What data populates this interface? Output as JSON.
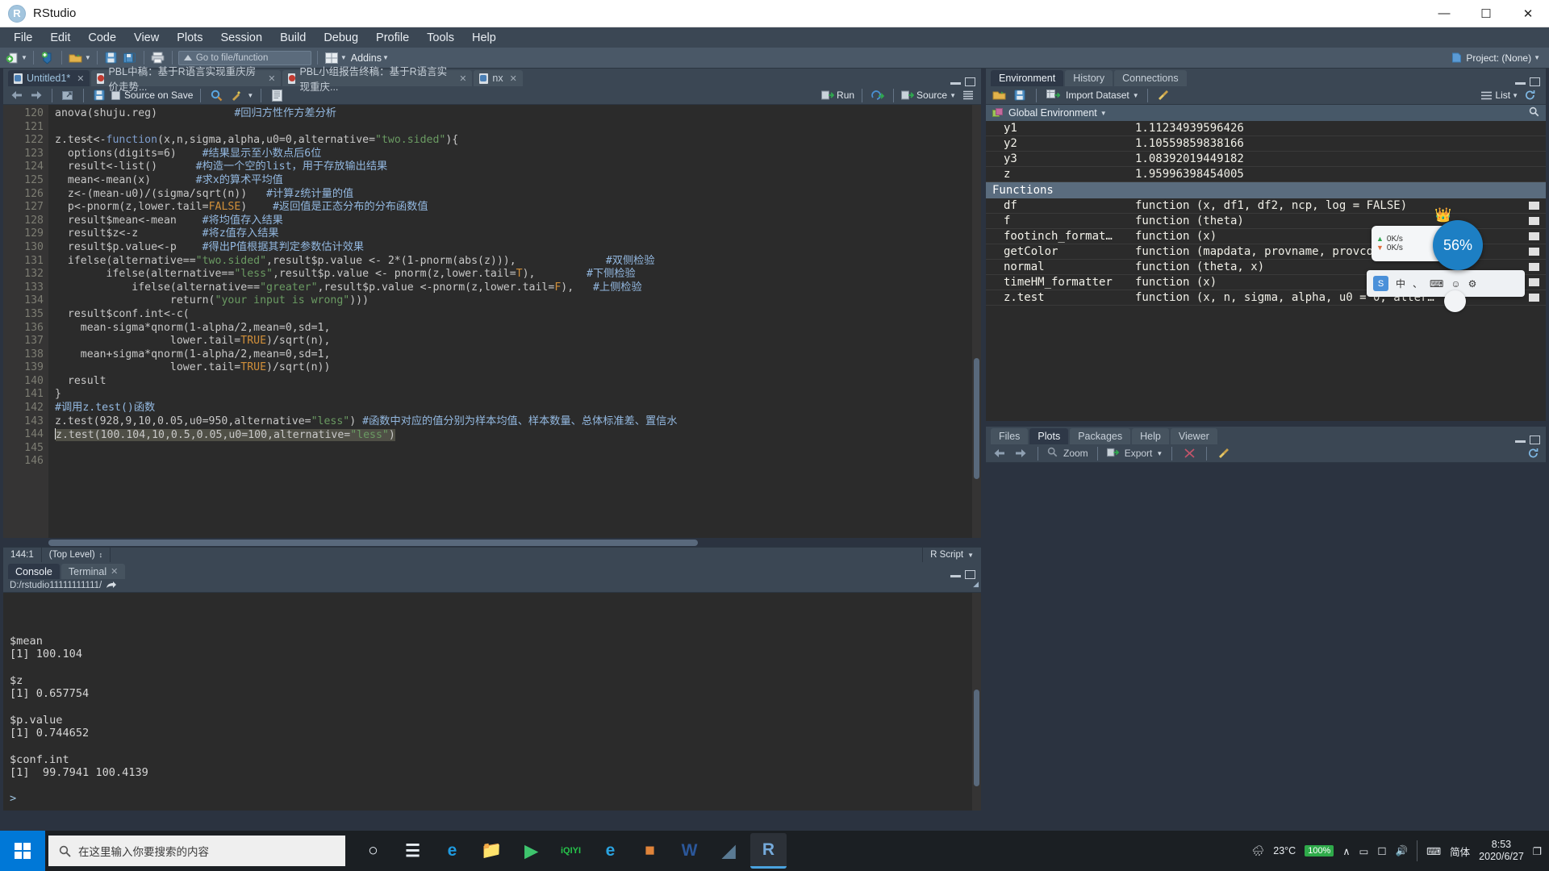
{
  "window": {
    "app_title": "RStudio",
    "logo_letter": "R",
    "minimize": "—",
    "maximize": "☐",
    "close": "✕"
  },
  "menubar": {
    "items": [
      "File",
      "Edit",
      "Code",
      "View",
      "Plots",
      "Session",
      "Build",
      "Debug",
      "Profile",
      "Tools",
      "Help"
    ]
  },
  "toolbar": {
    "goto_placeholder": "Go to file/function",
    "addins_label": "Addins",
    "project_label": "Project: (None)"
  },
  "source": {
    "tabs": [
      {
        "label": "Untitled1*",
        "icon": "r-file-icon",
        "active": true
      },
      {
        "label": "PBL中稿：基于R语言实现重庆房价走势...",
        "icon": "rmd-file-icon",
        "active": false
      },
      {
        "label": "PBL小组报告终稿：基于R语言实现重庆...",
        "icon": "rmd-file-icon",
        "active": false
      },
      {
        "label": "nx",
        "icon": "r-file-icon",
        "active": false
      }
    ],
    "toolbar": {
      "source_on_save": "Source on Save",
      "run_label": "Run",
      "source_label": "Source"
    },
    "status": {
      "position": "144:1",
      "scope": "(Top Level)",
      "filetype": "R Script"
    },
    "first_line_number": 120,
    "lines": [
      {
        "n": 120,
        "clipped": true,
        "tokens": [
          {
            "t": "anova(shuju.reg)",
            "c": "k-op"
          },
          {
            "t": "            #回归方性作方差分析",
            "c": "k-cmt"
          }
        ]
      },
      {
        "n": 121,
        "tokens": []
      },
      {
        "n": 122,
        "fold": true,
        "tokens": [
          {
            "t": "z.test<-",
            "c": "k-op"
          },
          {
            "t": "function",
            "c": "k-fn"
          },
          {
            "t": "(x,n,sigma,alpha,u0=0,alternative=",
            "c": "k-op"
          },
          {
            "t": "\"two.sided\"",
            "c": "k-str"
          },
          {
            "t": "){",
            "c": "k-op"
          }
        ]
      },
      {
        "n": 123,
        "tokens": [
          {
            "t": "  options(digits=6)",
            "c": "k-op"
          },
          {
            "t": "    #结果显示至小数点后6位",
            "c": "k-cmt"
          }
        ]
      },
      {
        "n": 124,
        "tokens": [
          {
            "t": "  result<-list()",
            "c": "k-op"
          },
          {
            "t": "      #构造一个空的list，用于存放输出结果",
            "c": "k-cmt"
          }
        ]
      },
      {
        "n": 125,
        "tokens": [
          {
            "t": "  mean<-mean(x)",
            "c": "k-op"
          },
          {
            "t": "       #求x的算术平均值",
            "c": "k-cmt"
          }
        ]
      },
      {
        "n": 126,
        "tokens": [
          {
            "t": "  z<-(mean-u0)/(sigma/sqrt(n))",
            "c": "k-op"
          },
          {
            "t": "   #计算z统计量的值",
            "c": "k-cmt"
          }
        ]
      },
      {
        "n": 127,
        "tokens": [
          {
            "t": "  p<-pnorm(z,lower.tail=",
            "c": "k-op"
          },
          {
            "t": "FALSE",
            "c": "k-const"
          },
          {
            "t": ")",
            "c": "k-op"
          },
          {
            "t": "    #返回值是正态分布的分布函数值",
            "c": "k-cmt"
          }
        ]
      },
      {
        "n": 128,
        "tokens": [
          {
            "t": "  result$mean<-mean",
            "c": "k-op"
          },
          {
            "t": "    #将均值存入结果",
            "c": "k-cmt"
          }
        ]
      },
      {
        "n": 129,
        "tokens": [
          {
            "t": "  result$z<-z",
            "c": "k-op"
          },
          {
            "t": "          #将z值存入结果",
            "c": "k-cmt"
          }
        ]
      },
      {
        "n": 130,
        "tokens": [
          {
            "t": "  result$p.value<-p",
            "c": "k-op"
          },
          {
            "t": "    #得出P值根据其判定参数估计效果",
            "c": "k-cmt"
          }
        ]
      },
      {
        "n": 131,
        "tokens": [
          {
            "t": "  ifelse(alternative==",
            "c": "k-op"
          },
          {
            "t": "\"two.sided\"",
            "c": "k-str"
          },
          {
            "t": ",result$p.value <- 2*(1-pnorm(abs(z))),",
            "c": "k-op"
          },
          {
            "t": "              #双侧检验",
            "c": "k-cmt"
          }
        ]
      },
      {
        "n": 132,
        "tokens": [
          {
            "t": "        ifelse(alternative==",
            "c": "k-op"
          },
          {
            "t": "\"less\"",
            "c": "k-str"
          },
          {
            "t": ",result$p.value <- pnorm(z,lower.tail=",
            "c": "k-op"
          },
          {
            "t": "T",
            "c": "k-const"
          },
          {
            "t": "),",
            "c": "k-op"
          },
          {
            "t": "        #下侧检验",
            "c": "k-cmt"
          }
        ]
      },
      {
        "n": 133,
        "tokens": [
          {
            "t": "            ifelse(alternative==",
            "c": "k-op"
          },
          {
            "t": "\"greater\"",
            "c": "k-str"
          },
          {
            "t": ",result$p.value <-pnorm(z,lower.tail=",
            "c": "k-op"
          },
          {
            "t": "F",
            "c": "k-const"
          },
          {
            "t": "),",
            "c": "k-op"
          },
          {
            "t": "   #上侧检验",
            "c": "k-cmt"
          }
        ]
      },
      {
        "n": 134,
        "tokens": [
          {
            "t": "                  return(",
            "c": "k-op"
          },
          {
            "t": "\"your input is wrong\"",
            "c": "k-str"
          },
          {
            "t": ")))",
            "c": "k-op"
          }
        ]
      },
      {
        "n": 135,
        "tokens": [
          {
            "t": "  result$conf.int<-c(",
            "c": "k-op"
          }
        ]
      },
      {
        "n": 136,
        "tokens": [
          {
            "t": "    mean-sigma*qnorm(1-alpha/2,mean=0,sd=1,",
            "c": "k-op"
          }
        ]
      },
      {
        "n": 137,
        "tokens": [
          {
            "t": "                  lower.tail=",
            "c": "k-op"
          },
          {
            "t": "TRUE",
            "c": "k-const"
          },
          {
            "t": ")/sqrt(n),",
            "c": "k-op"
          }
        ]
      },
      {
        "n": 138,
        "tokens": [
          {
            "t": "    mean+sigma*qnorm(1-alpha/2,mean=0,sd=1,",
            "c": "k-op"
          }
        ]
      },
      {
        "n": 139,
        "tokens": [
          {
            "t": "                  lower.tail=",
            "c": "k-op"
          },
          {
            "t": "TRUE",
            "c": "k-const"
          },
          {
            "t": ")/sqrt(n))",
            "c": "k-op"
          }
        ]
      },
      {
        "n": 140,
        "tokens": [
          {
            "t": "  result",
            "c": "k-op"
          }
        ]
      },
      {
        "n": 141,
        "tokens": [
          {
            "t": "}",
            "c": "k-op"
          }
        ]
      },
      {
        "n": 142,
        "tokens": [
          {
            "t": "#调用z.test()函数",
            "c": "k-cmt"
          }
        ]
      },
      {
        "n": 143,
        "tokens": [
          {
            "t": "z.test(928,9,10,0.05,u0=950,alternative=",
            "c": "k-op"
          },
          {
            "t": "\"less\"",
            "c": "k-str"
          },
          {
            "t": ")",
            "c": "k-op"
          },
          {
            "t": " #函数中对应的值分别为样本均值、样本数量、总体标准差、置信水",
            "c": "k-cmt"
          }
        ]
      },
      {
        "n": 144,
        "selected": true,
        "tokens": [
          {
            "t": "z.test(100.104,10,0.5,0.05,u0=100,alternative=",
            "c": "k-op"
          },
          {
            "t": "\"less\"",
            "c": "k-str"
          },
          {
            "t": ")",
            "c": "k-op"
          }
        ]
      },
      {
        "n": 145,
        "tokens": []
      },
      {
        "n": 146,
        "tokens": []
      }
    ]
  },
  "console": {
    "tabs": [
      {
        "label": "Console",
        "active": true,
        "closable": false
      },
      {
        "label": "Terminal",
        "active": false,
        "closable": true
      }
    ],
    "path": "D:/rstudio11111111111/",
    "output": [
      {
        "t": "$mean"
      },
      {
        "t": "[1] 100.104"
      },
      {
        "t": ""
      },
      {
        "t": "$z"
      },
      {
        "t": "[1] 0.657754"
      },
      {
        "t": ""
      },
      {
        "t": "$p.value"
      },
      {
        "t": "[1] 0.744652"
      },
      {
        "t": ""
      },
      {
        "t": "$conf.int"
      },
      {
        "t": "[1]  99.7941 100.4139"
      },
      {
        "t": ""
      },
      {
        "t": "> ",
        "prompt": true
      }
    ]
  },
  "environment": {
    "tabs": [
      {
        "label": "Environment",
        "active": true
      },
      {
        "label": "History",
        "active": false
      },
      {
        "label": "Connections",
        "active": false
      }
    ],
    "toolbar": {
      "import_dataset": "Import Dataset",
      "list_label": "List"
    },
    "scope": "Global Environment",
    "rows": [
      {
        "name": "y1",
        "value": "1.11234939596426",
        "type": "value"
      },
      {
        "name": "y2",
        "value": "1.10559859838166",
        "type": "value"
      },
      {
        "name": "y3",
        "value": "1.08392019449182",
        "type": "value"
      },
      {
        "name": "z",
        "value": "1.95996398454005",
        "type": "value"
      },
      {
        "name": "Functions",
        "section": true
      },
      {
        "name": "df",
        "value": "function (x, df1, df2, ncp, log = FALSE)",
        "type": "function"
      },
      {
        "name": "f",
        "value": "function (theta)",
        "type": "function"
      },
      {
        "name": "footinch_format…",
        "value": "function (x)",
        "type": "function"
      },
      {
        "name": "getColor",
        "value": "function (mapdata, provname, provcol, other…",
        "type": "function"
      },
      {
        "name": "normal",
        "value": "function (theta, x)",
        "type": "function"
      },
      {
        "name": "timeHM_formatter",
        "value": "function (x)",
        "type": "function"
      },
      {
        "name": "z.test",
        "value": "function (x, n, sigma, alpha, u0 = 0, alter…",
        "type": "function"
      }
    ]
  },
  "files_pane": {
    "tabs": [
      {
        "label": "Files",
        "active": false
      },
      {
        "label": "Plots",
        "active": true
      },
      {
        "label": "Packages",
        "active": false
      },
      {
        "label": "Help",
        "active": false
      },
      {
        "label": "Viewer",
        "active": false
      }
    ],
    "toolbar": {
      "zoom_label": "Zoom",
      "export_label": "Export"
    }
  },
  "floating": {
    "upload_rate": "0K/s",
    "download_rate": "0K/s",
    "percent": "56%",
    "ime_lang": "中",
    "ime_logo": "S"
  },
  "taskbar": {
    "search_placeholder": "在这里输入你要搜索的内容",
    "icons": [
      {
        "name": "cortana-icon",
        "glyph": "○",
        "color": "#e8eef4",
        "active": false
      },
      {
        "name": "task-view-icon",
        "glyph": "☰",
        "color": "#e8eef4",
        "active": false
      },
      {
        "name": "edge-icon",
        "glyph": "e",
        "color": "#1f9ae0",
        "active": false
      },
      {
        "name": "file-explorer-icon",
        "glyph": "📁",
        "color": "#f5c24a",
        "active": false
      },
      {
        "name": "play-store-icon",
        "glyph": "▶",
        "color": "#3ec46d",
        "active": false
      },
      {
        "name": "iqiyi-icon",
        "glyph": "iQIYI",
        "color": "#26c44b",
        "active": false
      },
      {
        "name": "browser-icon",
        "glyph": "e",
        "color": "#2aa3e0",
        "active": false
      },
      {
        "name": "microsoft-store-icon",
        "glyph": "■",
        "color": "#e0843a",
        "active": false
      },
      {
        "name": "word-icon",
        "glyph": "W",
        "color": "#2b579a",
        "active": false
      },
      {
        "name": "app-icon",
        "glyph": "◢",
        "color": "#5a7a93",
        "active": false
      },
      {
        "name": "rstudio-taskbar-icon",
        "glyph": "R",
        "color": "#75aadb",
        "active": true
      }
    ],
    "weather": {
      "icon": "rain-icon",
      "temp": "23°C"
    },
    "battery": "100%",
    "tray": {
      "chevron": "∧",
      "network": "▭",
      "monitor": "☐",
      "volume": "🔊",
      "keyboard": "⌨",
      "ime": "简体"
    },
    "clock": {
      "time": "8:53",
      "date": "2020/6/27"
    },
    "action_center": "❐"
  }
}
